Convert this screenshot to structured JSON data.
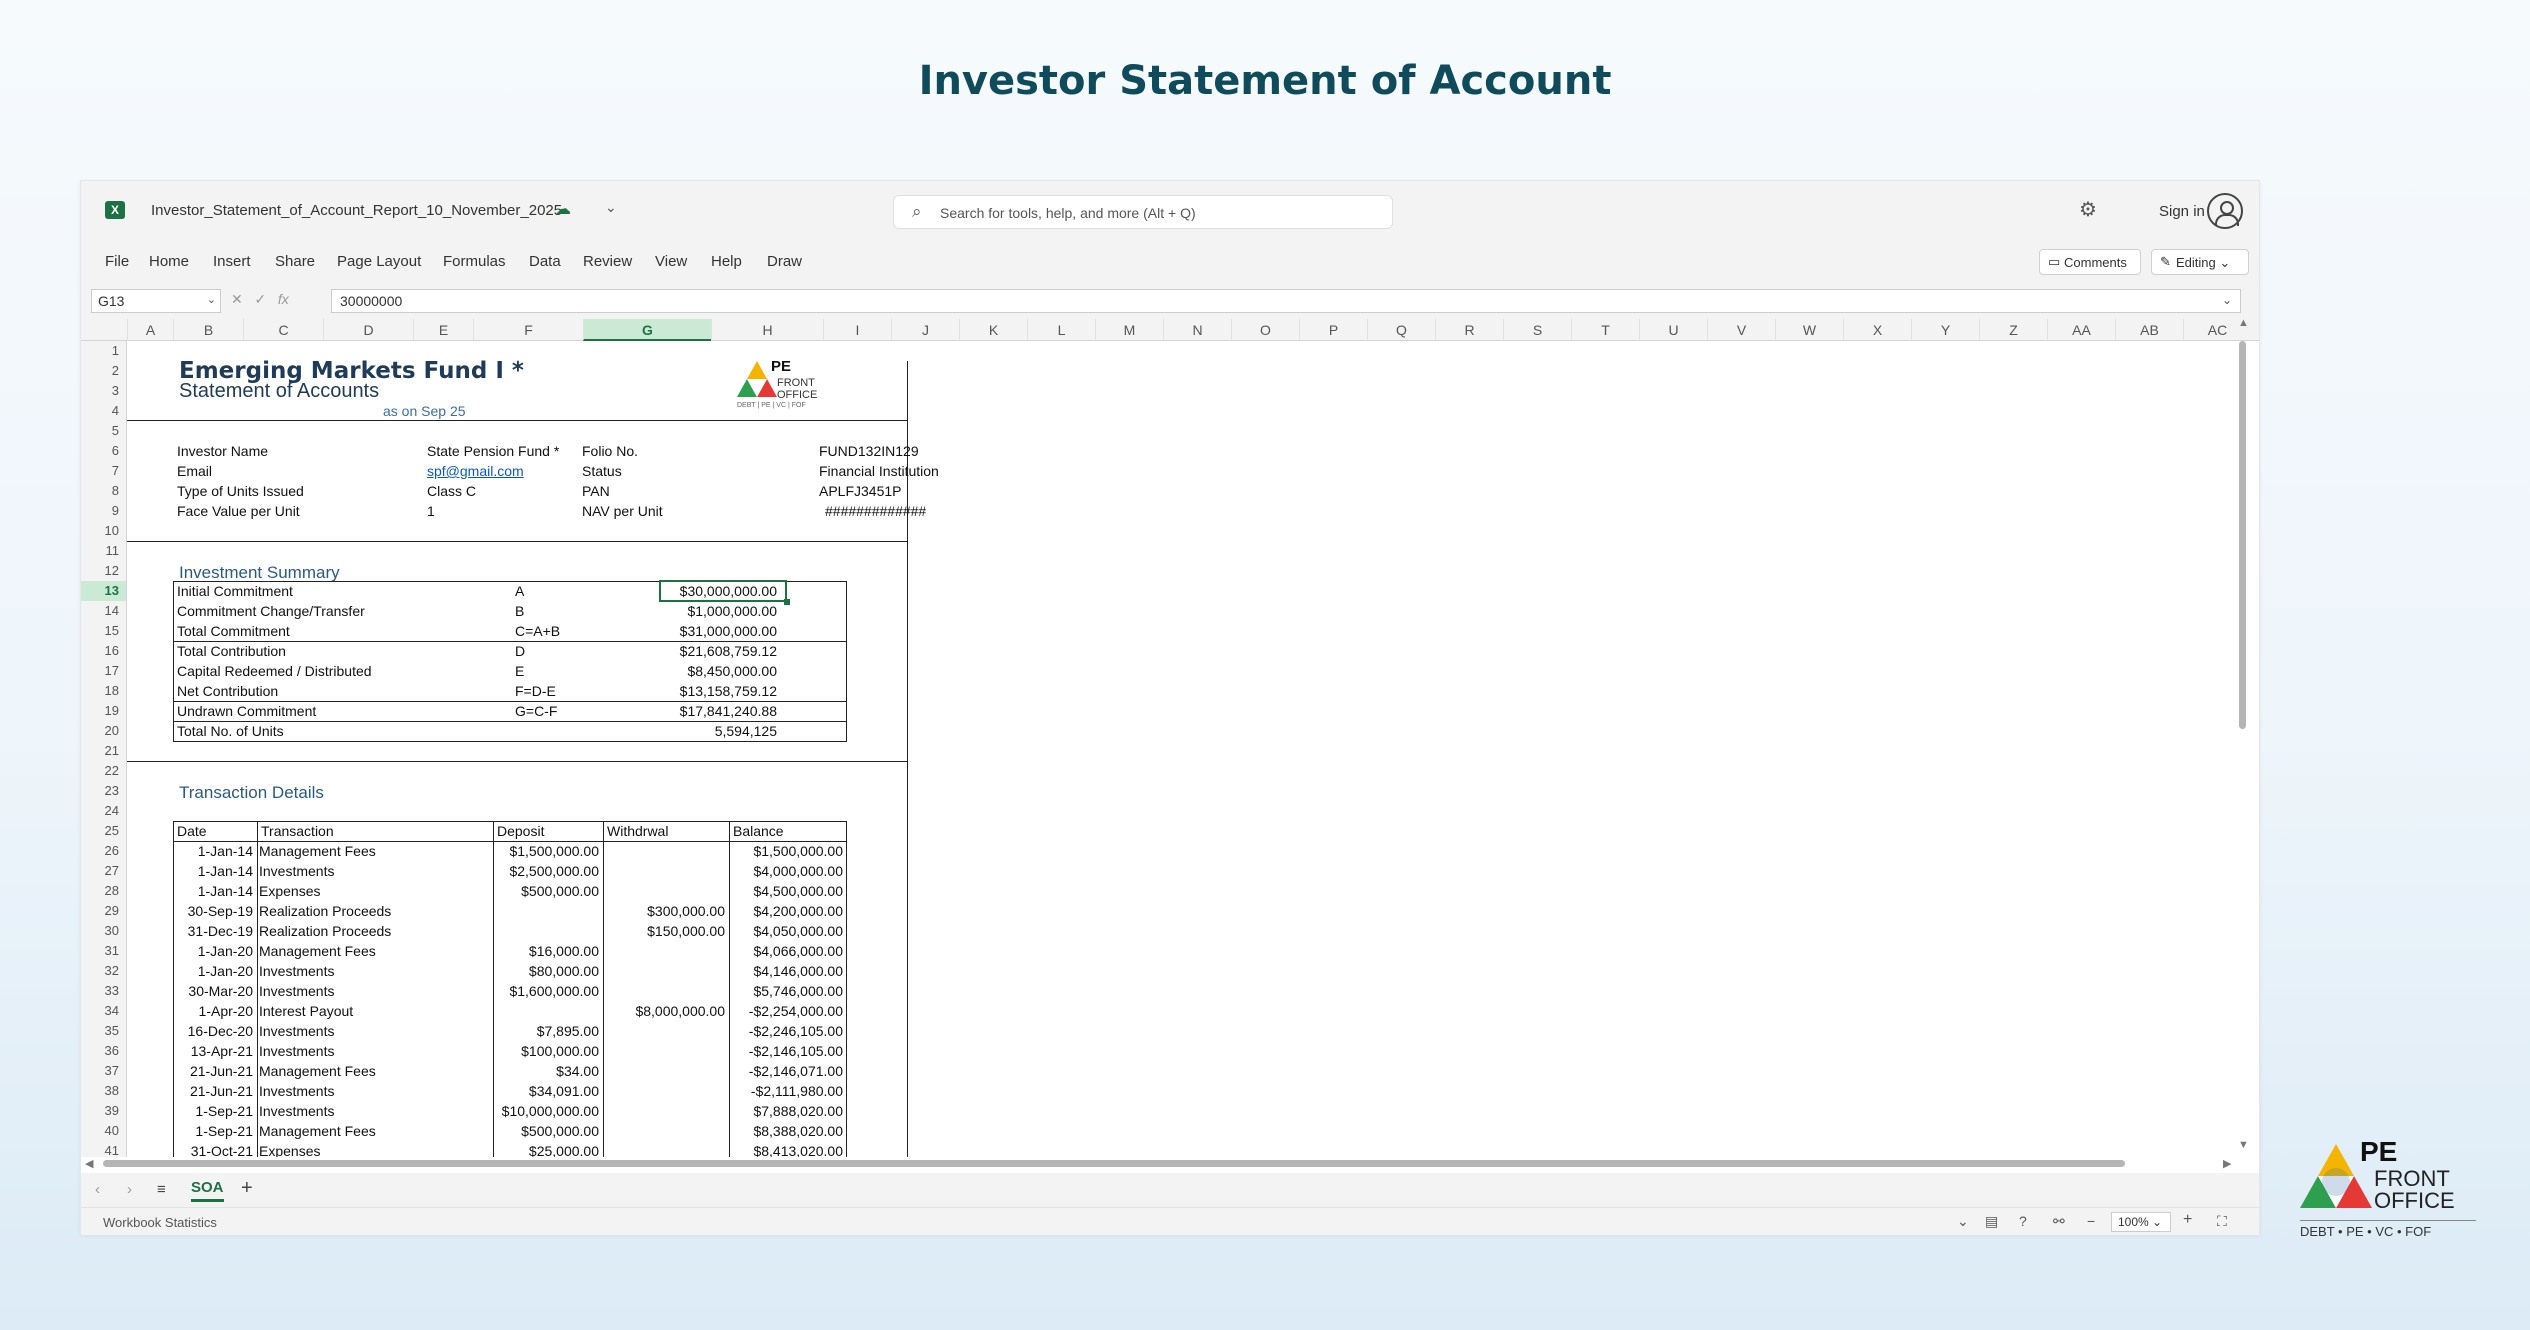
{
  "page": {
    "title": "Investor Statement of Account"
  },
  "window": {
    "filename": "Investor_Statement_of_Account_Report_10_November_2025",
    "search_placeholder": "Search for tools, help, and more (Alt + Q)",
    "sign_in": "Sign in"
  },
  "menu": [
    "File",
    "Home",
    "Insert",
    "Share",
    "Page Layout",
    "Formulas",
    "Data",
    "Review",
    "View",
    "Help",
    "Draw"
  ],
  "buttons": {
    "comments": "Comments",
    "editing": "Editing"
  },
  "formula_bar": {
    "name_box": "G13",
    "fx": "fx",
    "value": "30000000"
  },
  "columns": [
    "A",
    "B",
    "C",
    "D",
    "E",
    "F",
    "G",
    "H",
    "I",
    "J",
    "K",
    "L",
    "M",
    "N",
    "O",
    "P",
    "Q",
    "R",
    "S",
    "T",
    "U",
    "V",
    "W",
    "X",
    "Y",
    "Z",
    "AA",
    "AB",
    "AC"
  ],
  "selected_column": "G",
  "selected_row": 13,
  "rows": [
    1,
    2,
    3,
    4,
    5,
    6,
    7,
    8,
    9,
    10,
    11,
    12,
    13,
    14,
    15,
    16,
    17,
    18,
    19,
    20,
    21,
    22,
    23,
    24,
    25,
    26,
    27,
    28,
    29,
    30,
    31,
    32,
    33,
    34,
    35,
    36,
    37,
    38,
    39,
    40,
    41
  ],
  "statement": {
    "fund_name": "Emerging Markets Fund I *",
    "subtitle": "Statement of Accounts",
    "as_of": "as on Sep 25",
    "logo": {
      "pe": "PE",
      "front": "FRONT",
      "office": "OFFICE",
      "tagline": "DEBT | PE | VC | FOF"
    },
    "investor": {
      "name_label": "Investor Name",
      "name": "State Pension Fund *",
      "email_label": "Email",
      "email": "spf@gmail.com",
      "units_label": "Type of Units Issued",
      "units": "Class C",
      "face_label": "Face Value per Unit",
      "face": "1",
      "folio_label": "Folio No.",
      "folio": "FUND132IN129",
      "status_label": "Status",
      "status": "Financial Institution",
      "pan_label": "PAN",
      "pan": "APLFJ3451P",
      "nav_label": "NAV per Unit",
      "nav": "#############"
    },
    "summary_title": "Investment Summary",
    "summary": [
      {
        "label": "Initial Commitment",
        "code": "A",
        "value": "$30,000,000.00"
      },
      {
        "label": "Commitment Change/Transfer",
        "code": "B",
        "value": "$1,000,000.00"
      },
      {
        "label": "Total Commitment",
        "code": "C=A+B",
        "value": "$31,000,000.00"
      },
      {
        "label": "Total Contribution",
        "code": "D",
        "value": "$21,608,759.12"
      },
      {
        "label": "Capital Redeemed / Distributed",
        "code": "E",
        "value": "$8,450,000.00"
      },
      {
        "label": "Net Contribution",
        "code": "F=D-E",
        "value": "$13,158,759.12"
      },
      {
        "label": "Undrawn Commitment",
        "code": "G=C-F",
        "value": "$17,841,240.88"
      },
      {
        "label": "Total No. of Units",
        "code": "",
        "value": "5,594,125"
      }
    ],
    "transactions_title": "Transaction Details",
    "txn_headers": {
      "date": "Date",
      "txn": "Transaction",
      "deposit": "Deposit",
      "withdrawal": "Withdrwal",
      "balance": "Balance"
    },
    "transactions": [
      {
        "date": "1-Jan-14",
        "txn": "Management Fees",
        "deposit": "$1,500,000.00",
        "withdrawal": "",
        "balance": "$1,500,000.00"
      },
      {
        "date": "1-Jan-14",
        "txn": "Investments",
        "deposit": "$2,500,000.00",
        "withdrawal": "",
        "balance": "$4,000,000.00"
      },
      {
        "date": "1-Jan-14",
        "txn": "Expenses",
        "deposit": "$500,000.00",
        "withdrawal": "",
        "balance": "$4,500,000.00"
      },
      {
        "date": "30-Sep-19",
        "txn": "Realization Proceeds",
        "deposit": "",
        "withdrawal": "$300,000.00",
        "balance": "$4,200,000.00"
      },
      {
        "date": "31-Dec-19",
        "txn": "Realization Proceeds",
        "deposit": "",
        "withdrawal": "$150,000.00",
        "balance": "$4,050,000.00"
      },
      {
        "date": "1-Jan-20",
        "txn": "Management Fees",
        "deposit": "$16,000.00",
        "withdrawal": "",
        "balance": "$4,066,000.00"
      },
      {
        "date": "1-Jan-20",
        "txn": "Investments",
        "deposit": "$80,000.00",
        "withdrawal": "",
        "balance": "$4,146,000.00"
      },
      {
        "date": "30-Mar-20",
        "txn": "Investments",
        "deposit": "$1,600,000.00",
        "withdrawal": "",
        "balance": "$5,746,000.00"
      },
      {
        "date": "1-Apr-20",
        "txn": "Interest Payout",
        "deposit": "",
        "withdrawal": "$8,000,000.00",
        "balance": "-$2,254,000.00"
      },
      {
        "date": "16-Dec-20",
        "txn": "Investments",
        "deposit": "$7,895.00",
        "withdrawal": "",
        "balance": "-$2,246,105.00"
      },
      {
        "date": "13-Apr-21",
        "txn": "Investments",
        "deposit": "$100,000.00",
        "withdrawal": "",
        "balance": "-$2,146,105.00"
      },
      {
        "date": "21-Jun-21",
        "txn": "Management Fees",
        "deposit": "$34.00",
        "withdrawal": "",
        "balance": "-$2,146,071.00"
      },
      {
        "date": "21-Jun-21",
        "txn": "Investments",
        "deposit": "$34,091.00",
        "withdrawal": "",
        "balance": "-$2,111,980.00"
      },
      {
        "date": "1-Sep-21",
        "txn": "Investments",
        "deposit": "$10,000,000.00",
        "withdrawal": "",
        "balance": "$7,888,020.00"
      },
      {
        "date": "1-Sep-21",
        "txn": "Management Fees",
        "deposit": "$500,000.00",
        "withdrawal": "",
        "balance": "$8,388,020.00"
      },
      {
        "date": "31-Oct-21",
        "txn": "Expenses",
        "deposit": "$25,000.00",
        "withdrawal": "",
        "balance": "$8,413,020.00"
      }
    ]
  },
  "sheet_tab": "SOA",
  "status": {
    "text": "Workbook Statistics",
    "zoom": "100%"
  },
  "brand": {
    "pe": "PE",
    "front": "FRONT",
    "office": "OFFICE",
    "tagline": "DEBT • PE • VC • FOF"
  },
  "colors": {
    "excel_green": "#1e7145",
    "title": "#0f4b5a"
  }
}
